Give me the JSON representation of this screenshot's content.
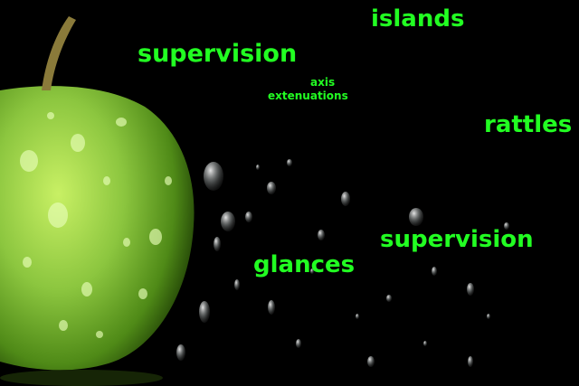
{
  "overlay_words": {
    "islands": "islands",
    "supervision_top": "supervision",
    "axis": "axis",
    "extenuations": "extenuations",
    "rattles": "rattles",
    "supervision_bottom": "supervision",
    "glances": "glances"
  },
  "colors": {
    "background": "#000000",
    "text": "#22ff22",
    "apple": "#8cc63f"
  }
}
